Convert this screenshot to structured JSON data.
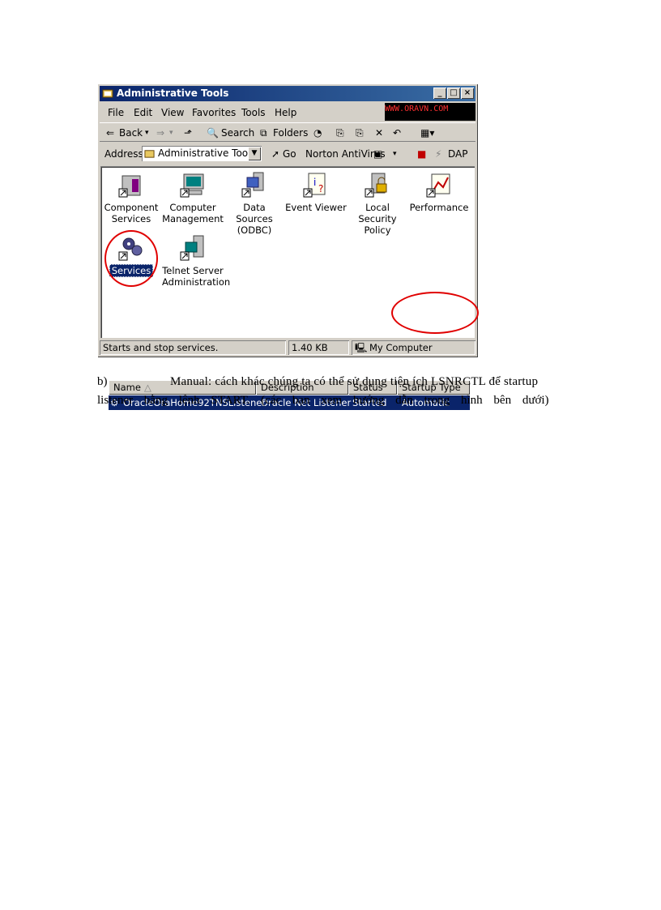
{
  "window": {
    "title": "Administrative Tools",
    "controls": {
      "minimize": "_",
      "maximize": "□",
      "close": "×"
    }
  },
  "menu": {
    "items": [
      "File",
      "Edit",
      "View",
      "Favorites",
      "Tools",
      "Help"
    ],
    "watermark": "WWW.ORAVN.COM"
  },
  "toolbar": {
    "back": "Back",
    "search": "Search",
    "folders": "Folders"
  },
  "address": {
    "label": "Address",
    "value": "Administrative Tools",
    "go": "Go",
    "norton": "Norton AntiVirus",
    "dap": "DAP"
  },
  "icons": [
    {
      "label": "Component Services"
    },
    {
      "label": "Computer Management"
    },
    {
      "label": "Data Sources (ODBC)"
    },
    {
      "label": "Event Viewer"
    },
    {
      "label": "Local Security Policy"
    },
    {
      "label": "Performance"
    },
    {
      "label": "Services"
    },
    {
      "label": "Telnet Server Administration"
    }
  ],
  "table": {
    "headers": [
      "Name",
      "Description",
      "Status",
      "Startup Type"
    ],
    "rows": [
      {
        "name": "OracleOraHome92TNSListener",
        "description": "Oracle Net Listener",
        "status": "Started",
        "startup": "Automatic"
      }
    ]
  },
  "statusbar": {
    "text": "Starts and stop services.",
    "size": "1.40 KB",
    "zone": "My Computer"
  },
  "body_text": {
    "line1_prefix": "b)",
    "line1": "Manual: cách khác chúng ta có thể sử dụng tiện ích LSNRCTL để startup",
    "line2": "listener bằng lệnh START. (các bạn xem hướng dẫn trong hình bên dưới)"
  },
  "colors": {
    "titlebar": "#0a246a",
    "selection": "#0a246a",
    "highlight_circle": "#e00000",
    "face": "#d4d0c8"
  }
}
